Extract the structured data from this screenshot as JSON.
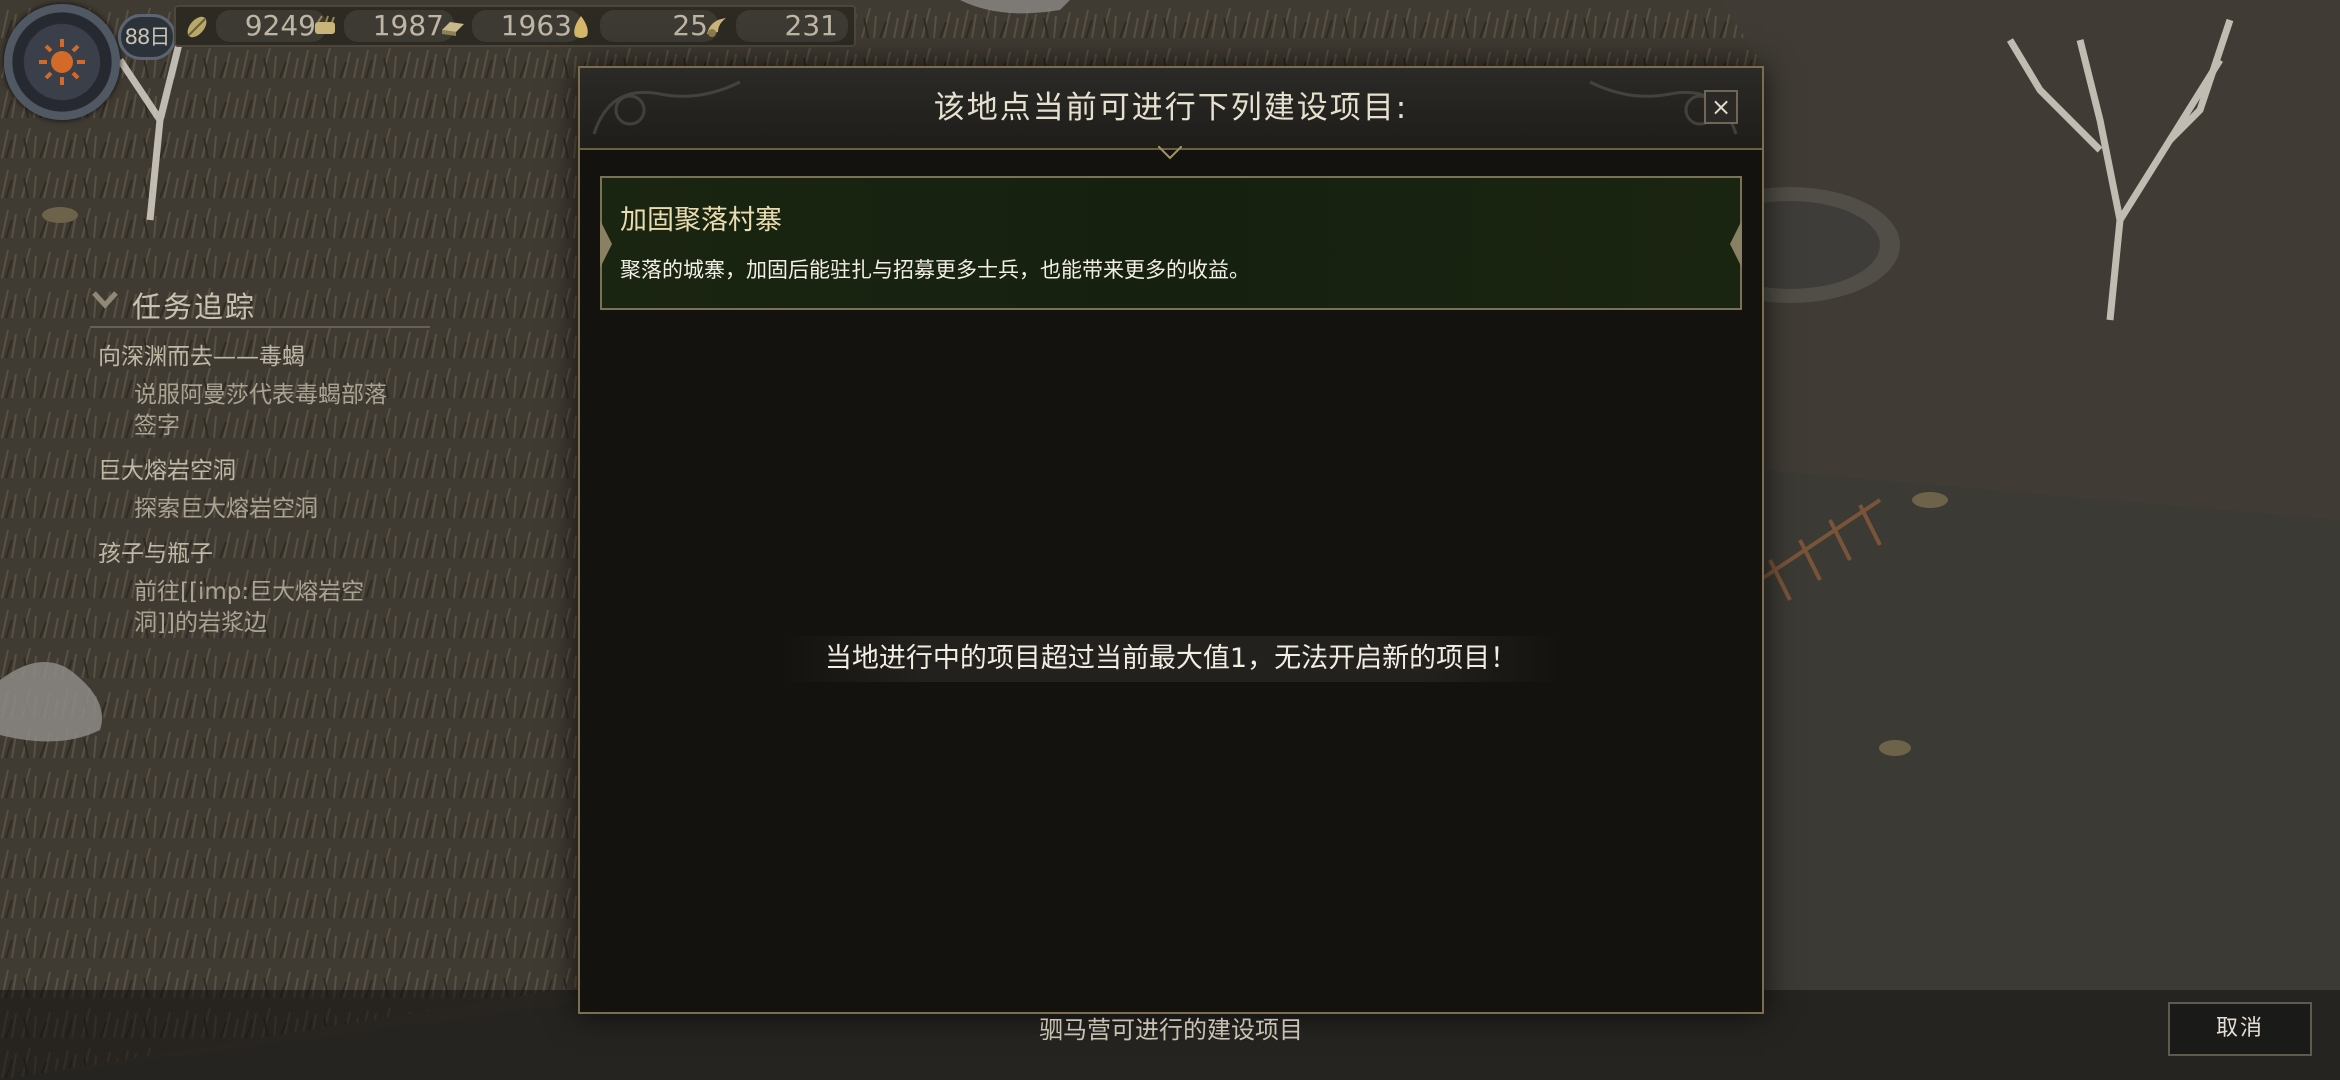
{
  "hud": {
    "day": "88日",
    "resources": [
      {
        "icon": "leaf-icon",
        "value": "9249"
      },
      {
        "icon": "grain-icon",
        "value": "1987"
      },
      {
        "icon": "iron-icon",
        "value": "1963"
      },
      {
        "icon": "gold-icon",
        "value": "25"
      },
      {
        "icon": "horn-icon",
        "value": "231"
      }
    ]
  },
  "quest_tracker": {
    "title": "任务追踪",
    "quests": [
      {
        "title": "向深渊而去——毒蝎",
        "objective": "说服阿曼莎代表毒蝎部落签字"
      },
      {
        "title": "巨大熔岩空洞",
        "objective": "探索巨大熔岩空洞"
      },
      {
        "title": "孩子与瓶子",
        "objective": "前往[[imp:巨大熔岩空洞]]的岩浆边"
      }
    ]
  },
  "modal": {
    "title": "该地点当前可进行下列建设项目:",
    "close_label": "×",
    "project": {
      "name": "加固聚落村寨",
      "description": "聚落的城寨，加固后能驻扎与招募更多士兵，也能带来更多的收益。"
    },
    "limit_message": "当地进行中的项目超过当前最大值1，无法开启新的项目！"
  },
  "footer": {
    "label": "驷马营可进行的建设项目",
    "cancel_label": "取消"
  },
  "colors": {
    "modal_bg": "#13120e",
    "gold_border": "#7c6d4f",
    "card_bg": "#1a2511",
    "project_name": "#e9dcb0"
  }
}
